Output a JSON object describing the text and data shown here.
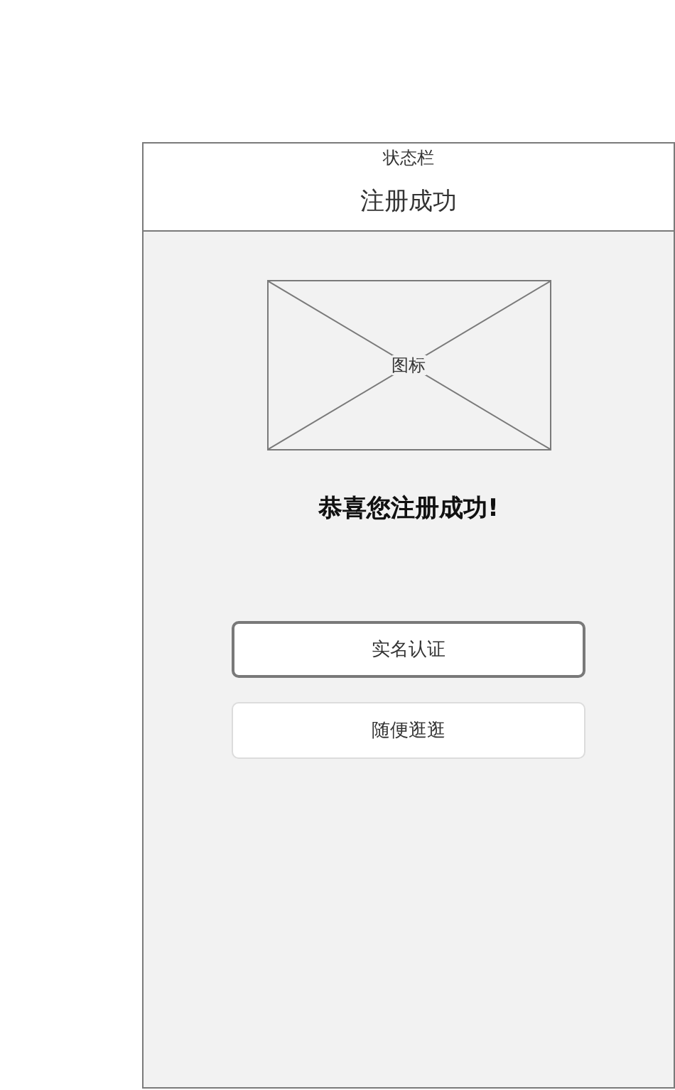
{
  "status_bar": {
    "label": "状态栏"
  },
  "nav_bar": {
    "title": "注册成功"
  },
  "icon_placeholder": {
    "label": "图标"
  },
  "message": "恭喜您注册成功!",
  "buttons": [
    {
      "label": "实名认证",
      "selected": true
    },
    {
      "label": "随便逛逛",
      "selected": false
    }
  ]
}
